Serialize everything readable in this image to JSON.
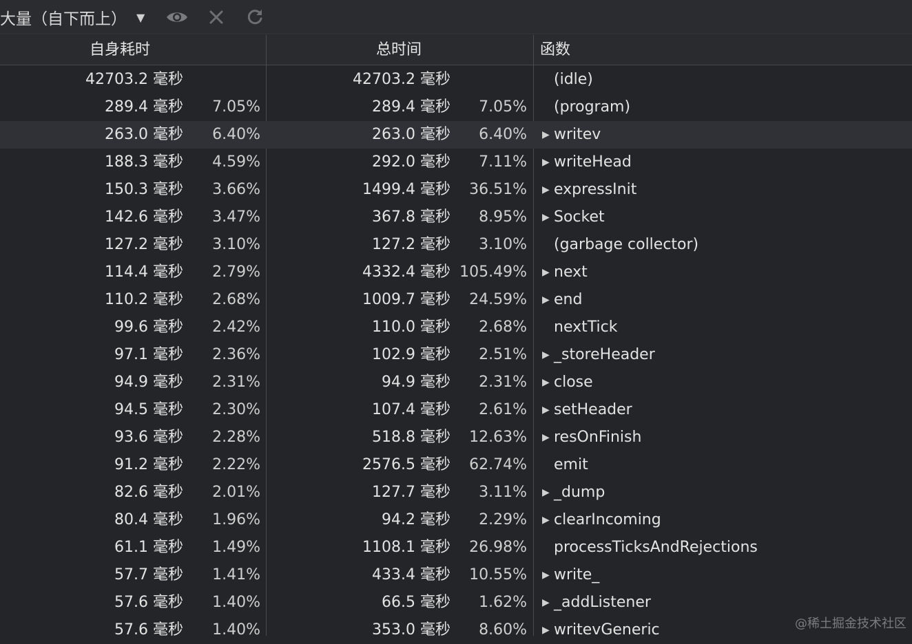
{
  "toolbar": {
    "view_mode": "大量（自下而上）",
    "caret": "▼",
    "icons": [
      "eye-icon",
      "close-icon",
      "refresh-icon"
    ]
  },
  "columns": {
    "self_time": "自身耗时",
    "total_time": "总时间",
    "function": "函数"
  },
  "rows": [
    {
      "self": "42703.2 毫秒",
      "self_pct": "",
      "total": "42703.2 毫秒",
      "total_pct": "",
      "expand": "",
      "fn": "(idle)"
    },
    {
      "self": "289.4 毫秒",
      "self_pct": "7.05%",
      "total": "289.4 毫秒",
      "total_pct": "7.05%",
      "expand": "",
      "fn": "(program)"
    },
    {
      "self": "263.0 毫秒",
      "self_pct": "6.40%",
      "total": "263.0 毫秒",
      "total_pct": "6.40%",
      "expand": "▶",
      "fn": "writev"
    },
    {
      "self": "188.3 毫秒",
      "self_pct": "4.59%",
      "total": "292.0 毫秒",
      "total_pct": "7.11%",
      "expand": "▶",
      "fn": "writeHead"
    },
    {
      "self": "150.3 毫秒",
      "self_pct": "3.66%",
      "total": "1499.4 毫秒",
      "total_pct": "36.51%",
      "expand": "▶",
      "fn": "expressInit"
    },
    {
      "self": "142.6 毫秒",
      "self_pct": "3.47%",
      "total": "367.8 毫秒",
      "total_pct": "8.95%",
      "expand": "▶",
      "fn": "Socket"
    },
    {
      "self": "127.2 毫秒",
      "self_pct": "3.10%",
      "total": "127.2 毫秒",
      "total_pct": "3.10%",
      "expand": "",
      "fn": "(garbage collector)"
    },
    {
      "self": "114.4 毫秒",
      "self_pct": "2.79%",
      "total": "4332.4 毫秒",
      "total_pct": "105.49%",
      "expand": "▶",
      "fn": "next"
    },
    {
      "self": "110.2 毫秒",
      "self_pct": "2.68%",
      "total": "1009.7 毫秒",
      "total_pct": "24.59%",
      "expand": "▶",
      "fn": "end"
    },
    {
      "self": "99.6 毫秒",
      "self_pct": "2.42%",
      "total": "110.0 毫秒",
      "total_pct": "2.68%",
      "expand": "",
      "fn": "nextTick"
    },
    {
      "self": "97.1 毫秒",
      "self_pct": "2.36%",
      "total": "102.9 毫秒",
      "total_pct": "2.51%",
      "expand": "▶",
      "fn": "_storeHeader"
    },
    {
      "self": "94.9 毫秒",
      "self_pct": "2.31%",
      "total": "94.9 毫秒",
      "total_pct": "2.31%",
      "expand": "▶",
      "fn": "close"
    },
    {
      "self": "94.5 毫秒",
      "self_pct": "2.30%",
      "total": "107.4 毫秒",
      "total_pct": "2.61%",
      "expand": "▶",
      "fn": "setHeader"
    },
    {
      "self": "93.6 毫秒",
      "self_pct": "2.28%",
      "total": "518.8 毫秒",
      "total_pct": "12.63%",
      "expand": "▶",
      "fn": "resOnFinish"
    },
    {
      "self": "91.2 毫秒",
      "self_pct": "2.22%",
      "total": "2576.5 毫秒",
      "total_pct": "62.74%",
      "expand": "",
      "fn": "emit"
    },
    {
      "self": "82.6 毫秒",
      "self_pct": "2.01%",
      "total": "127.7 毫秒",
      "total_pct": "3.11%",
      "expand": "▶",
      "fn": "_dump"
    },
    {
      "self": "80.4 毫秒",
      "self_pct": "1.96%",
      "total": "94.2 毫秒",
      "total_pct": "2.29%",
      "expand": "▶",
      "fn": "clearIncoming"
    },
    {
      "self": "61.1 毫秒",
      "self_pct": "1.49%",
      "total": "1108.1 毫秒",
      "total_pct": "26.98%",
      "expand": "",
      "fn": "processTicksAndRejections"
    },
    {
      "self": "57.7 毫秒",
      "self_pct": "1.41%",
      "total": "433.4 毫秒",
      "total_pct": "10.55%",
      "expand": "▶",
      "fn": "write_"
    },
    {
      "self": "57.6 毫秒",
      "self_pct": "1.40%",
      "total": "66.5 毫秒",
      "total_pct": "1.62%",
      "expand": "▶",
      "fn": "_addListener"
    },
    {
      "self": "57.6 毫秒",
      "self_pct": "1.40%",
      "total": "353.0 毫秒",
      "total_pct": "8.60%",
      "expand": "▶",
      "fn": "writevGeneric"
    }
  ],
  "selected_row": 2,
  "watermark": "@稀土掘金技术社区"
}
